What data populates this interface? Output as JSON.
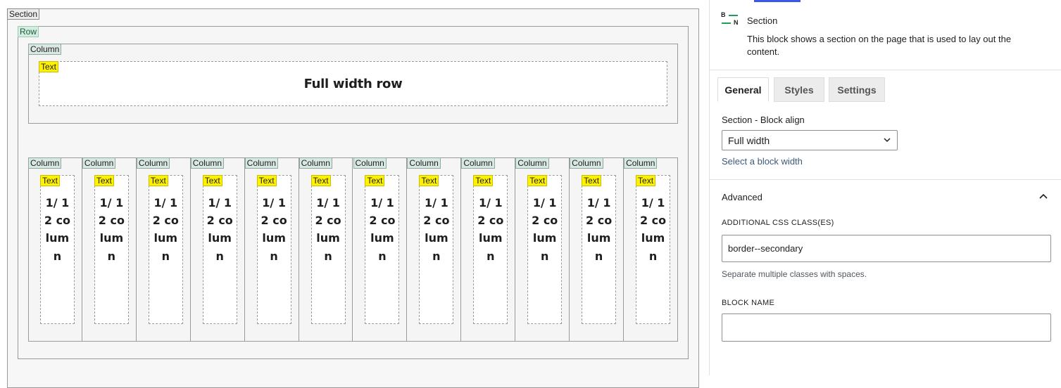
{
  "canvas": {
    "section_tag": "Section",
    "row_tag": "Row",
    "column_tag": "Column",
    "text_tag": "Text",
    "full_width_text": "Full width row",
    "twelfth_column_text": "1/ 12 column",
    "twelfth_columns_count": 12
  },
  "inspector": {
    "block": {
      "logo_letters": [
        "B",
        "N"
      ],
      "title": "Section",
      "description": "This block shows a section on the page that is used to lay out the content."
    },
    "tabs": [
      {
        "label": "General",
        "active": true
      },
      {
        "label": "Styles",
        "active": false
      },
      {
        "label": "Settings",
        "active": false
      }
    ],
    "block_align": {
      "label": "Section - Block align",
      "value": "Full width",
      "help": "Select a block width"
    },
    "advanced": {
      "title": "Advanced",
      "expanded": true,
      "css_label": "ADDITIONAL CSS CLASS(ES)",
      "css_value": "border--secondary",
      "css_help": "Separate multiple classes with spaces.",
      "name_label": "BLOCK NAME",
      "name_value": ""
    }
  },
  "colors": {
    "accent": "#3858e9",
    "text_tag": "#fff200",
    "row_tag": "#d3eee0",
    "brand_green": "#1e9e5a"
  }
}
